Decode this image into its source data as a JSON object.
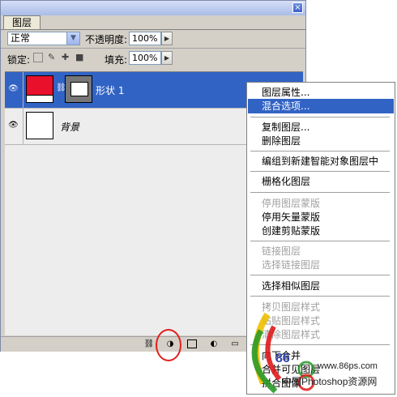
{
  "panel": {
    "tab_label": "图层",
    "close_glyph": "×",
    "blend_mode": "正常",
    "opacity_label": "不透明度:",
    "opacity_value": "100%",
    "lock_label": "锁定:",
    "fill_label": "填充:",
    "fill_value": "100%",
    "layers": [
      {
        "name": "形状 1",
        "selected": true,
        "swatch_color": "#e8102a"
      },
      {
        "name": "背景",
        "selected": false,
        "swatch_color": "#ffffff"
      }
    ]
  },
  "context_menu": {
    "items": [
      {
        "label": "图层属性...",
        "state": "normal"
      },
      {
        "label": "混合选项...",
        "state": "highlighted"
      },
      {
        "label": "复制图层...",
        "state": "normal"
      },
      {
        "label": "删除图层",
        "state": "normal"
      },
      {
        "label": "编组到新建智能对象图层中",
        "state": "normal"
      },
      {
        "label": "栅格化图层",
        "state": "normal"
      },
      {
        "label": "停用图层蒙版",
        "state": "disabled"
      },
      {
        "label": "停用矢量蒙版",
        "state": "normal"
      },
      {
        "label": "创建剪贴蒙版",
        "state": "normal"
      },
      {
        "label": "链接图层",
        "state": "disabled"
      },
      {
        "label": "选择链接图层",
        "state": "disabled"
      },
      {
        "label": "选择相似图层",
        "state": "normal"
      },
      {
        "label": "拷贝图层样式",
        "state": "disabled"
      },
      {
        "label": "粘贴图层样式",
        "state": "disabled"
      },
      {
        "label": "清除图层样式",
        "state": "disabled"
      },
      {
        "label": "向下合并",
        "state": "normal"
      },
      {
        "label": "合并可见图层",
        "state": "normal"
      },
      {
        "label": "拼合图像",
        "state": "normal"
      }
    ]
  },
  "watermark": {
    "url": "www.86ps.com",
    "brand": "86",
    "site_name": "中国Photoshop资源网"
  },
  "colors": {
    "selection_blue": "#3163c5",
    "annotation_red": "#e0201d"
  }
}
